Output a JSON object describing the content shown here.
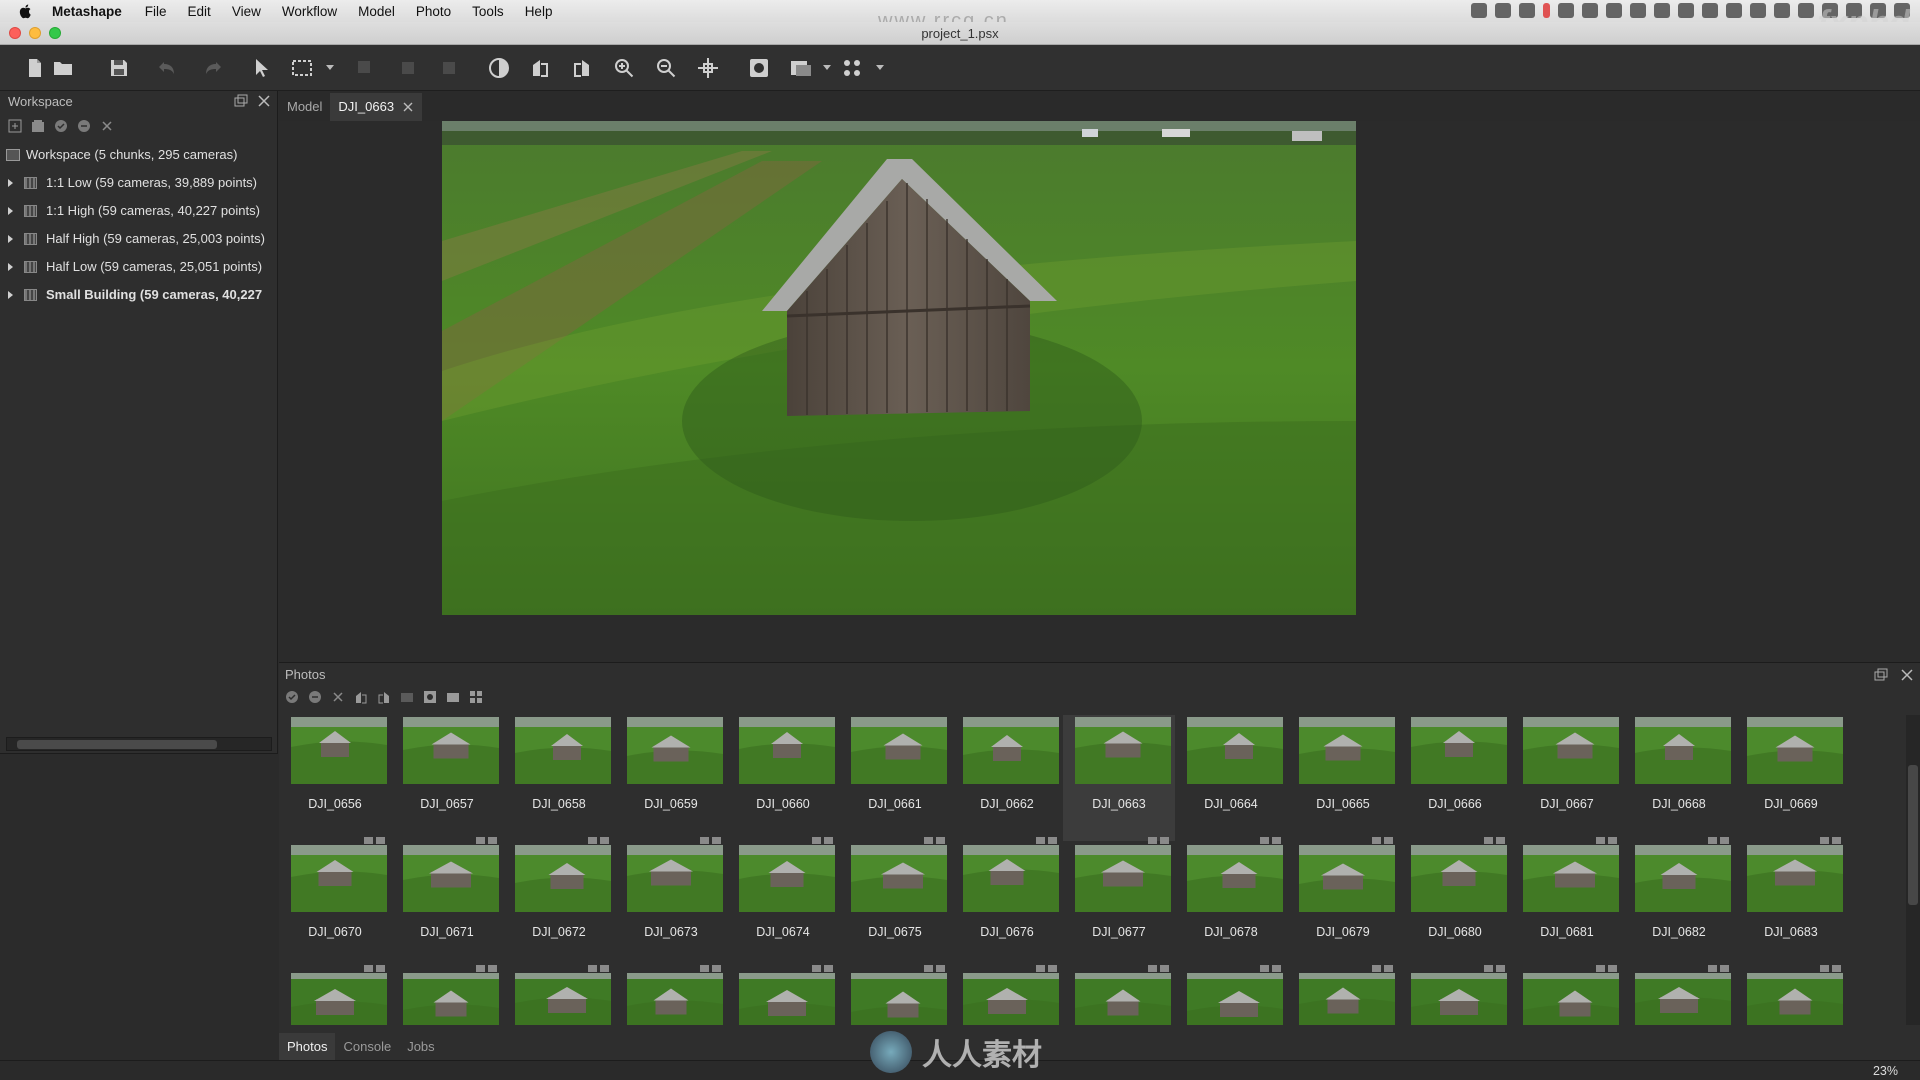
{
  "menubar": {
    "app_name": "Metashape",
    "items": [
      "File",
      "Edit",
      "View",
      "Workflow",
      "Model",
      "Photo",
      "Tools",
      "Help"
    ]
  },
  "window": {
    "title": "project_1.psx"
  },
  "toolbar": {
    "icons": [
      "new-document-icon",
      "open-folder-icon",
      "save-icon",
      "undo-icon",
      "redo-icon",
      "navigation-arrow-icon",
      "rectangle-selection-icon",
      "move-object-icon",
      "rotate-object-icon",
      "scale-object-icon",
      "contrast-icon",
      "rotate-left-icon",
      "rotate-right-icon",
      "zoom-in-icon",
      "zoom-out-icon",
      "reset-view-icon",
      "show-masks-icon",
      "shading-mode-icon",
      "show-points-icon"
    ]
  },
  "workspace": {
    "title": "Workspace",
    "root": "Workspace (5 chunks, 295 cameras)",
    "chunks": [
      {
        "label": "1:1 Low (59 cameras, 39,889 points)",
        "bold": false
      },
      {
        "label": "1:1 High (59 cameras, 40,227 points)",
        "bold": false
      },
      {
        "label": "Half High (59 cameras, 25,003 points)",
        "bold": false
      },
      {
        "label": "Half Low (59 cameras, 25,051 points)",
        "bold": false
      },
      {
        "label": "Small Building (59 cameras, 40,227",
        "bold": true
      }
    ]
  },
  "tabs": [
    {
      "label": "Model",
      "active": false
    },
    {
      "label": "DJI_0663",
      "active": true
    }
  ],
  "photos": {
    "title": "Photos",
    "selected": "DJI_0663",
    "rows": [
      [
        "DJI_0656",
        "DJI_0657",
        "DJI_0658",
        "DJI_0659",
        "DJI_0660",
        "DJI_0661",
        "DJI_0662",
        "DJI_0663",
        "DJI_0664",
        "DJI_0665",
        "DJI_0666",
        "DJI_0667",
        "DJI_0668",
        "DJI_0669"
      ],
      [
        "DJI_0670",
        "DJI_0671",
        "DJI_0672",
        "DJI_0673",
        "DJI_0674",
        "DJI_0675",
        "DJI_0676",
        "DJI_0677",
        "DJI_0678",
        "DJI_0679",
        "DJI_0680",
        "DJI_0681",
        "DJI_0682",
        "DJI_0683"
      ],
      [
        "",
        "",
        "",
        "",
        "",
        "",
        "",
        "",
        "",
        "",
        "",
        "",
        "",
        ""
      ]
    ],
    "bottom_tabs": [
      {
        "label": "Photos",
        "active": true
      },
      {
        "label": "Console",
        "active": false
      },
      {
        "label": "Jobs",
        "active": false
      }
    ]
  },
  "status": {
    "zoom": "23%"
  },
  "watermarks": {
    "top": "www.rrcg.cn",
    "corner": "fxphd",
    "bottom": "人人素材"
  },
  "colors": {
    "grass": "#4f8a2a",
    "barn": "#5a4e44",
    "roof": "#a9aaa7"
  }
}
